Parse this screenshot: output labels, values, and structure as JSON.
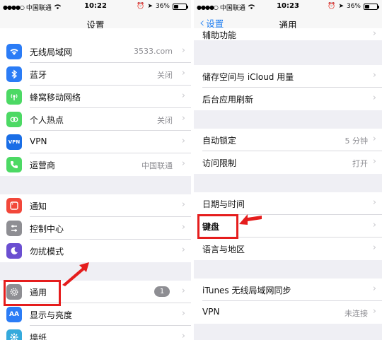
{
  "status": {
    "carrier": "中国联通",
    "battery": "36%",
    "time_left": "10:22",
    "time_right": "10:23"
  },
  "left": {
    "title": "设置",
    "rows": [
      {
        "label": "无线局域网",
        "value": "3533.com",
        "icon": "wifi-icon",
        "color": "#2b7cf6"
      },
      {
        "label": "蓝牙",
        "value": "关闭",
        "icon": "bluetooth-icon",
        "color": "#2b7cf6"
      },
      {
        "label": "蜂窝移动网络",
        "value": "",
        "icon": "cellular-icon",
        "color": "#4cd964"
      },
      {
        "label": "个人热点",
        "value": "关闭",
        "icon": "hotspot-icon",
        "color": "#4cd964"
      },
      {
        "label": "VPN",
        "value": "",
        "icon": "vpn-icon",
        "color": "#1a6ee6"
      },
      {
        "label": "运营商",
        "value": "中国联通",
        "icon": "phone-icon",
        "color": "#4cd964"
      },
      {
        "label": "通知",
        "value": "",
        "icon": "notifications-icon",
        "color": "#f2473a"
      },
      {
        "label": "控制中心",
        "value": "",
        "icon": "control-center-icon",
        "color": "#8e8e93"
      },
      {
        "label": "勿扰模式",
        "value": "",
        "icon": "moon-icon",
        "color": "#6b4fd1"
      },
      {
        "label": "通用",
        "value": "",
        "badge": "1",
        "icon": "gear-icon",
        "color": "#8e8e93"
      },
      {
        "label": "显示与亮度",
        "value": "",
        "icon": "display-icon",
        "color": "#2b7cf6"
      },
      {
        "label": "墙纸",
        "value": "",
        "icon": "wallpaper-icon",
        "color": "#35aadc"
      }
    ]
  },
  "right": {
    "back": "设置",
    "title": "通用",
    "rows": [
      {
        "label": "辅助功能",
        "value": ""
      },
      {
        "label": "储存空间与 iCloud 用量",
        "value": ""
      },
      {
        "label": "后台应用刷新",
        "value": ""
      },
      {
        "label": "自动锁定",
        "value": "5 分钟"
      },
      {
        "label": "访问限制",
        "value": "打开"
      },
      {
        "label": "日期与时间",
        "value": ""
      },
      {
        "label": "键盘",
        "value": ""
      },
      {
        "label": "语言与地区",
        "value": ""
      },
      {
        "label": "iTunes 无线局域网同步",
        "value": ""
      },
      {
        "label": "VPN",
        "value": "未连接"
      }
    ]
  },
  "colors": {
    "highlight": "#e51d1d",
    "ios_blue": "#1a7cf2",
    "background": "#efeff4"
  }
}
